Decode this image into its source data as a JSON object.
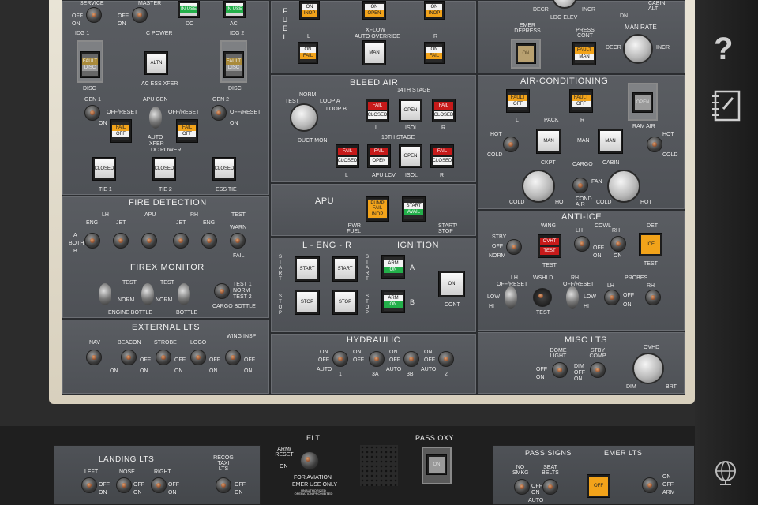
{
  "service": "SERVICE",
  "master": "MASTER",
  "off": "OFF",
  "on": "ON",
  "inuse": "IN USE",
  "dc": "DC",
  "ac": "AC",
  "idg1": "IDG 1",
  "cpower": "C POWER",
  "idg2": "IDG 2",
  "fault": "FAULT",
  "disc": "DISC",
  "altn": "ALTN",
  "ac_ess_xfer": "AC ESS XFER",
  "gen1": "GEN 1",
  "apu_gen": "APU GEN",
  "gen2": "GEN 2",
  "off_reset": "OFF/RESET",
  "fail": "FAIL",
  "auto": "AUTO",
  "xfer": "XFER",
  "dc_power": "DC POWER",
  "closed": "CLOSED",
  "tie1": "TIE 1",
  "tie2": "TIE 2",
  "ess_tie": "ESS TIE",
  "fire_det": "FIRE DETECTION",
  "lh": "LH",
  "apu": "APU",
  "rh": "RH",
  "test": "TEST",
  "eng": "ENG",
  "jet": "JET",
  "a": "A",
  "both": "BOTH",
  "b": "B",
  "warn": "WARN",
  "firex": "FIREX MONITOR",
  "norm": "NORM",
  "engine_bottle": "ENGINE BOTTLE",
  "bottle": "BOTTLE",
  "test1": "TEST 1",
  "test2": "TEST 2",
  "cargo_bottle": "CARGO BOTTLE",
  "ext_lts": "EXTERNAL LTS",
  "nav": "NAV",
  "beacon": "BEACON",
  "strobe": "STROBE",
  "logo": "LOGO",
  "wing_insp": "WING INSP",
  "fuel": "FUEL",
  "inop": "INOP",
  "open": "OPEN",
  "xflow": "XFLOW",
  "auto_override": "AUTO OVERRIDE",
  "l": "L",
  "r": "R",
  "man": "MAN",
  "bleed_air": "BLEED AIR",
  "stage14": "14TH STAGE",
  "stage10": "10TH STAGE",
  "duct_mon": "DUCT MON",
  "loop_a": "LOOP A",
  "loop_b": "LOOP B",
  "isol": "ISOL",
  "apu_lcv": "APU LCV",
  "apu_title": "APU",
  "pwr_fuel": "PWR FUEL",
  "pump_fail": "PUMP FAIL",
  "start": "START",
  "aval": "AVAIL",
  "start_stop": "START/ STOP",
  "l_eng_r": "L - ENG - R",
  "stop": "STOP",
  "ignition": "IGNITION",
  "arm": "ARM",
  "cont": "CONT",
  "hydraulic": "HYDRAULIC",
  "h1": "1",
  "h3a": "3A",
  "h3b": "3B",
  "h2": "2",
  "decr": "DECR",
  "incr": "INCR",
  "ldg_elev": "LDG ELEV",
  "dn": "DN",
  "cabin_alt": "CABIN ALT",
  "emer_depress": "EMER DEPRESS",
  "press_cont": "PRESS CONT",
  "man_rate": "MAN RATE",
  "up": "UP",
  "air_cond": "AIR-CONDITIONING",
  "pack": "PACK",
  "ram_air": "RAM AIR",
  "hot": "HOT",
  "cold": "COLD",
  "ckpt": "CKPT",
  "cargo": "CARGO",
  "cabin": "CABIN",
  "cond_air": "COND AIR",
  "fan": "FAN",
  "anti_ice": "ANTI-ICE",
  "wing": "WING",
  "cowl": "COWL",
  "det": "DET",
  "stby": "STBY",
  "ice": "ICE",
  "ovht": "OVHT",
  "low": "LOW",
  "hi": "HI",
  "wshld": "WSHLD",
  "probes": "PROBES",
  "misc_lts": "MISC LTS",
  "dome_light": "DOME LIGHT",
  "stby_comp": "STBY COMP",
  "dim": "DIM",
  "ovhd": "OVHD",
  "brt": "BRT",
  "landing_lts": "LANDING LTS",
  "left": "LEFT",
  "nose": "NOSE",
  "right": "RIGHT",
  "recog": "RECOG TAXI LTS",
  "elt": "ELT",
  "arm_reset": "ARM/ RESET",
  "for_aviation": "FOR AVIATION",
  "emer_use": "EMER USE ONLY",
  "unauth": "UNAUTHORIZED OPERATION PROHIBITED",
  "pass_oxy": "PASS OXY",
  "pass_signs": "PASS SIGNS",
  "emer_lts": "EMER LTS",
  "no_smkg": "NO SMKG",
  "seat_belts": "SEAT BELTS",
  "help_icon": "?"
}
